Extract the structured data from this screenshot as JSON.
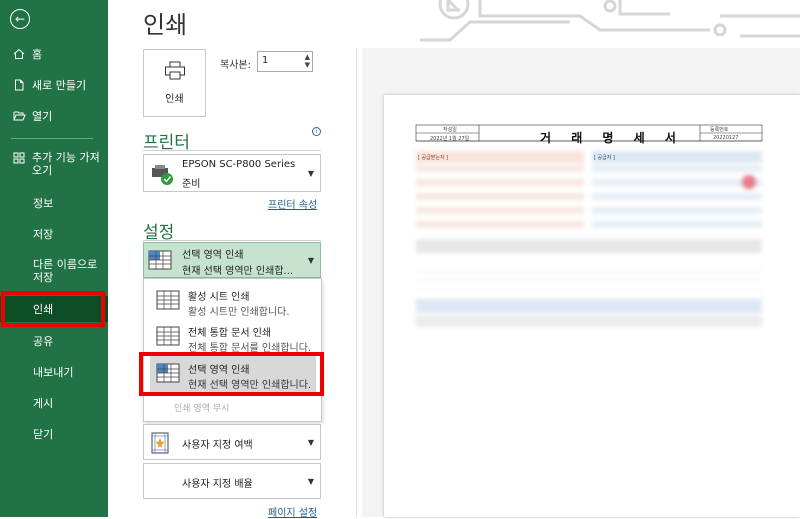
{
  "nav": {
    "items": [
      {
        "label": "홈",
        "icon": "home-icon"
      },
      {
        "label": "새로 만들기",
        "icon": "new-file-icon"
      },
      {
        "label": "열기",
        "icon": "folder-open-icon"
      },
      {
        "label": "추가 기능 가져오기",
        "icon": "addins-icon"
      },
      {
        "label": "정보"
      },
      {
        "label": "저장"
      },
      {
        "label": "다른 이름으로 저장"
      },
      {
        "label": "인쇄"
      },
      {
        "label": "공유"
      },
      {
        "label": "내보내기"
      },
      {
        "label": "게시"
      },
      {
        "label": "닫기"
      }
    ],
    "active_color": "#0e4e27",
    "bg_color": "#217346"
  },
  "page_title": "인쇄",
  "print_button": {
    "label": "인쇄",
    "icon": "printer-icon"
  },
  "copies": {
    "label": "복사본:",
    "value": "1"
  },
  "printer": {
    "section": "프린터",
    "name": "EPSON SC-P800 Series",
    "status": "준비",
    "properties_link": "프린터 속성"
  },
  "settings": {
    "section": "설정",
    "selected": {
      "title": "선택 영역 인쇄",
      "desc": "현재 선택 영역만 인쇄합..."
    },
    "options": [
      {
        "title": "활성 시트 인쇄",
        "desc": "활성 시트만 인쇄합니다."
      },
      {
        "title": "전체 통합 문서 인쇄",
        "desc": "전체 통합 문서를 인쇄합니다."
      },
      {
        "title": "선택 영역 인쇄",
        "desc": "현재 선택 영역만 인쇄합니다."
      }
    ],
    "ignore_print_area": "인쇄 영역 무시",
    "margins": "사용자 지정 여백",
    "scaling": "사용자 지정 배율",
    "page_setup_link": "페이지 설정"
  },
  "preview": {
    "doc_title": "거 래 명 세 서",
    "label_left": "작성일",
    "date": "2022년 1월 27일",
    "label_right": "등록번호",
    "number": "20220127",
    "supplier_tag": "[ 공급받는자 ]",
    "provider_tag": "[ 공급자 ]"
  },
  "colors": {
    "accent": "#217346",
    "highlight": "#ff0000"
  }
}
